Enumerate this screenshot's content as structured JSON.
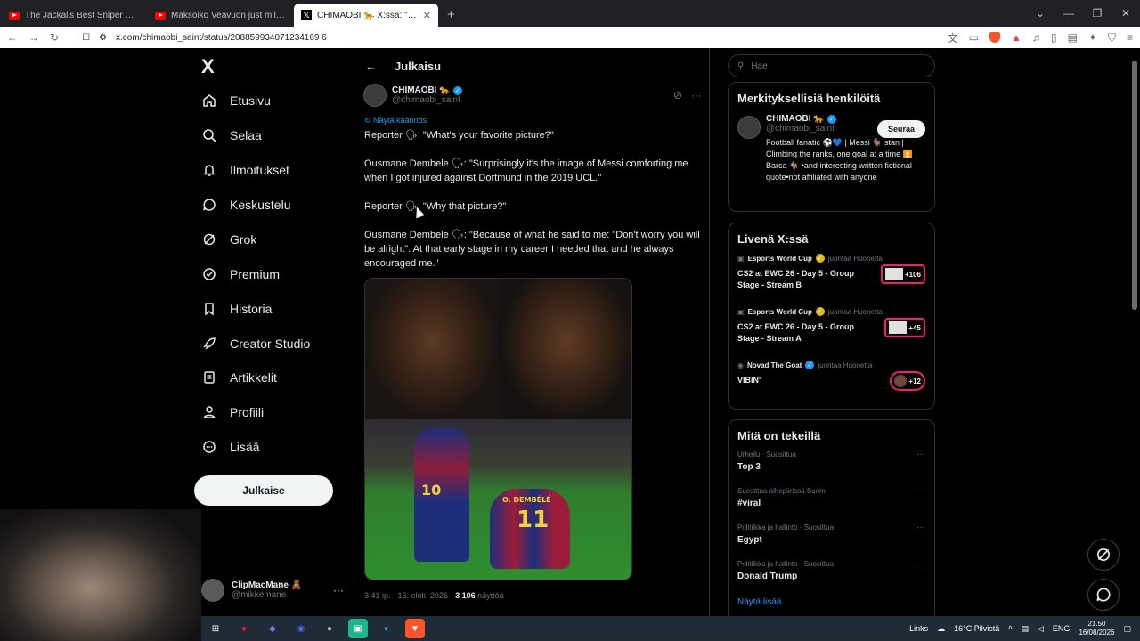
{
  "browser": {
    "tabs": [
      {
        "title": "The Jackal's Best Sniper Kills | The Da",
        "icon": "youtube"
      },
      {
        "title": "Maksoiko Veavuon just miljoonan vi",
        "icon": "youtube"
      },
      {
        "title": "CHIMAOBI 🐆 X:ssä: \"Reporter 🗣",
        "icon": "x",
        "active": true
      }
    ],
    "url": "x.com/chimaobi_saint/status/208859934071234169 6",
    "new_tab_symbol": "+"
  },
  "sidebar": {
    "logo": "X",
    "items": [
      {
        "label": "Etusivu",
        "icon": "home-icon"
      },
      {
        "label": "Selaa",
        "icon": "search-icon"
      },
      {
        "label": "Ilmoitukset",
        "icon": "bell-icon"
      },
      {
        "label": "Keskustelu",
        "icon": "chat-icon"
      },
      {
        "label": "Grok",
        "icon": "grok-icon"
      },
      {
        "label": "Premium",
        "icon": "premium-icon"
      },
      {
        "label": "Historia",
        "icon": "bookmark-icon"
      },
      {
        "label": "Creator Studio",
        "icon": "rocket-icon"
      },
      {
        "label": "Artikkelit",
        "icon": "article-icon"
      },
      {
        "label": "Profiili",
        "icon": "person-icon"
      },
      {
        "label": "Lisää",
        "icon": "more-icon"
      }
    ],
    "post_button": "Julkaise",
    "account": {
      "name": "ClipMacMane 🧸",
      "handle": "@mikkemane",
      "more": "···"
    }
  },
  "main": {
    "header_title": "Julkaisu",
    "author": {
      "name": "CHIMAOBI 🐆",
      "handle": "@chimaobi_saint"
    },
    "translate_link": "Näytä käännös",
    "tweet_lines": [
      "Reporter 🗣: \"What's your favorite picture?\"",
      "Ousmane Dembele 🗣: \"Surprisingly it's the image of Messi comforting me when I got injured against Dortmund in the 2019 UCL.\"",
      "Reporter 🗣: \"Why that picture?\"",
      "Ousmane Dembele 🗣: \"Because of what he said to me: \"Don't worry you will be alright\". At that early stage in my career I needed that and he always encouraged me.\""
    ],
    "meta": {
      "time": "3.41 ip. · 16. elok. 2026 · ",
      "views_count": "3 106",
      "views_label": " näyttöä"
    },
    "jersey_numbers": {
      "messi": "10",
      "dembele": "11",
      "dembele_name": "O. DEMBÉLÉ"
    }
  },
  "right": {
    "search_placeholder": "Hae",
    "relevant": {
      "title": "Merkityksellisiä henkilöitä",
      "name": "CHIMAOBI 🐆",
      "handle": "@chimaobi_saint",
      "follow": "Seuraa",
      "bio": "Football fanatic ⚽💙 | Messi 🐐 stan | Climbing the ranks, one goal at a time ⏫ | Barca 🐐 •and interesting written fictional quote•not affiliated with anyone"
    },
    "live": {
      "title": "Livenä X:ssä",
      "items": [
        {
          "host": "Esports World Cup",
          "suffix": "juontaa Huonetta",
          "title": "CS2 at EWC 26 - Day 5 - Group Stage - Stream B",
          "count": "+106"
        },
        {
          "host": "Esports World Cup",
          "suffix": "juontaa Huonetta",
          "title": "CS2 at EWC 26 - Day 5 - Group Stage - Stream A",
          "count": "+45"
        },
        {
          "host": "Novad The Goat",
          "suffix": "juontaa Huonetta",
          "title": "VIBIN'",
          "count": "+12"
        }
      ]
    },
    "trends": {
      "title": "Mitä on tekeillä",
      "items": [
        {
          "meta": "Urheilu · Suosittua",
          "name": "Top 3"
        },
        {
          "meta": "Suosittua aihepiirissä Suomi",
          "name": "#viral"
        },
        {
          "meta": "Politiikka ja hallinto · Suosittua",
          "name": "Egypt"
        },
        {
          "meta": "Politiikka ja hallinto · Suosittua",
          "name": "Donald Trump"
        }
      ],
      "show_more": "Näytä lisää"
    }
  },
  "taskbar": {
    "links": "Links",
    "weather": "16°C Pilvistä",
    "lang": "ENG",
    "time": "21.50",
    "date": "16/08/2026"
  },
  "colors": {
    "accent": "#1d9bf0",
    "live": "#f91880",
    "background": "#000000",
    "border": "#2f3336"
  }
}
